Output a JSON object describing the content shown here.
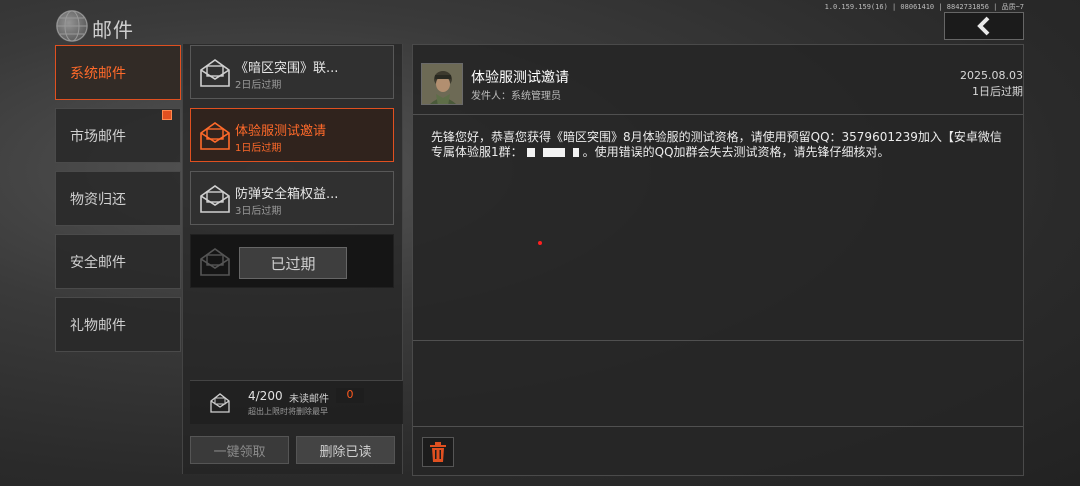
{
  "header": {
    "title": "邮件",
    "version": "1.0.159.159(16) | 08061410 | 8842731856 | 品质~7",
    "back_icon": "chevron-left-icon"
  },
  "tabs": [
    {
      "label": "系统邮件",
      "active": true
    },
    {
      "label": "市场邮件",
      "active": false,
      "badge": true
    },
    {
      "label": "物资归还",
      "active": false
    },
    {
      "label": "安全邮件",
      "active": false
    },
    {
      "label": "礼物邮件",
      "active": false
    }
  ],
  "mail_list": [
    {
      "title": "《暗区突围》联...",
      "sub": "2日后过期",
      "state": "normal"
    },
    {
      "title": "体验服测试邀请",
      "sub": "1日后过期",
      "state": "active"
    },
    {
      "title": "防弹安全箱权益...",
      "sub": "3日后过期",
      "state": "normal"
    },
    {
      "title": "",
      "sub": "",
      "state": "expired",
      "tag": "已过期"
    }
  ],
  "counter": {
    "count": "4/200",
    "unread_label": "未读邮件",
    "unread_num": "0",
    "note": "超出上限时将删除最早"
  },
  "buttons": {
    "claim_all": "一键领取",
    "delete_read": "删除已读"
  },
  "detail": {
    "subject": "体验服测试邀请",
    "sender": "发件人：系统管理员",
    "date": "2025.08.03",
    "expire": "1日后过期",
    "body_part1": "先锋您好，恭喜您获得《暗区突围》8月体验服的测试资格，请使用预留QQ：3579601239加入【安卓微信专属体验服1群：",
    "body_part2": "。使用错误的QQ加群会失去测试资格，请先锋仔细核对。"
  },
  "colors": {
    "accent": "#e05020",
    "accent_text": "#ff6a2a"
  }
}
